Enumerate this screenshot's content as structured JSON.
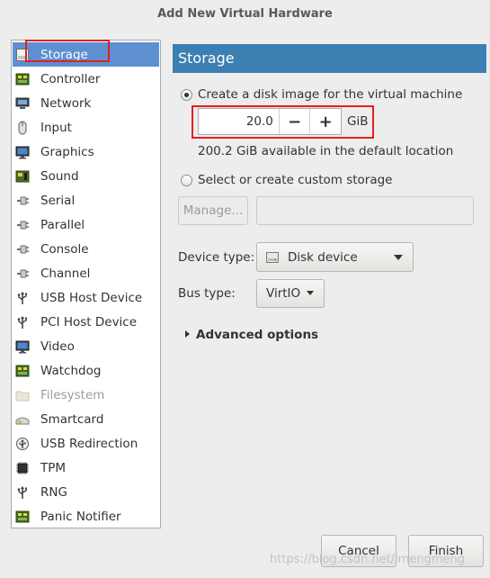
{
  "window": {
    "title": "Add New Virtual Hardware"
  },
  "sidebar": {
    "items": [
      {
        "label": "Storage",
        "icon": "disk-icon",
        "selected": true
      },
      {
        "label": "Controller",
        "icon": "chip-icon"
      },
      {
        "label": "Network",
        "icon": "network-icon"
      },
      {
        "label": "Input",
        "icon": "mouse-icon"
      },
      {
        "label": "Graphics",
        "icon": "monitor-icon"
      },
      {
        "label": "Sound",
        "icon": "sound-card-icon"
      },
      {
        "label": "Serial",
        "icon": "plug-icon"
      },
      {
        "label": "Parallel",
        "icon": "plug-icon"
      },
      {
        "label": "Console",
        "icon": "plug-icon"
      },
      {
        "label": "Channel",
        "icon": "plug-icon"
      },
      {
        "label": "USB Host Device",
        "icon": "usb-icon"
      },
      {
        "label": "PCI Host Device",
        "icon": "usb-icon"
      },
      {
        "label": "Video",
        "icon": "monitor-icon"
      },
      {
        "label": "Watchdog",
        "icon": "chip-icon"
      },
      {
        "label": "Filesystem",
        "icon": "folder-icon",
        "disabled": true
      },
      {
        "label": "Smartcard",
        "icon": "smartcard-icon"
      },
      {
        "label": "USB Redirection",
        "icon": "usb-redirect-icon"
      },
      {
        "label": "TPM",
        "icon": "tpm-chip-icon"
      },
      {
        "label": "RNG",
        "icon": "usb-icon"
      },
      {
        "label": "Panic Notifier",
        "icon": "chip-icon"
      }
    ]
  },
  "main": {
    "header": "Storage",
    "create_disk_label": "Create a disk image for the virtual machine",
    "size_value": "20.0",
    "size_unit": "GiB",
    "minus_symbol": "−",
    "plus_symbol": "+",
    "available_text": "200.2 GiB available in the default location",
    "custom_storage_label": "Select or create custom storage",
    "manage_button": "Manage...",
    "custom_path_value": "",
    "device_type_label": "Device type:",
    "device_type_value": "Disk device",
    "bus_type_label": "Bus type:",
    "bus_type_value": "VirtIO",
    "advanced_options": "Advanced options"
  },
  "footer": {
    "cancel": "Cancel",
    "finish": "Finish",
    "watermark": "https://blog.csdn.net/lmengmeng"
  },
  "colors": {
    "selection": "#5e8fd1",
    "header": "#3c7fb2",
    "highlight_box": "#e02020"
  }
}
